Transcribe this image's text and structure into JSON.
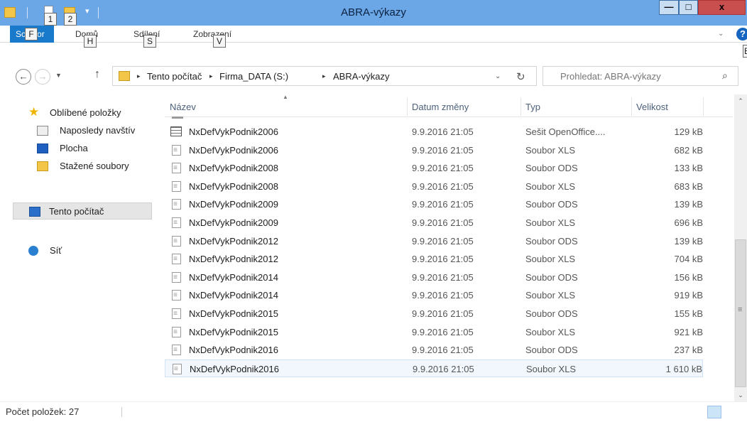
{
  "window": {
    "title": "ABRA-výkazy",
    "minimize_label": "—",
    "maximize_label": "□",
    "close_label": "x"
  },
  "quick_access": {
    "dropdown_glyph": "▾",
    "keytips": [
      "1",
      "2"
    ]
  },
  "ribbon": {
    "tabs": [
      {
        "label": "Soubor",
        "keytip": "F"
      },
      {
        "label": "Domů",
        "keytip": "H"
      },
      {
        "label": "Sdílení",
        "keytip": "S"
      },
      {
        "label": "Zobrazení",
        "keytip": "V"
      }
    ],
    "file_tab_visible": "Sc",
    "file_tab_visible_end": "or",
    "help_label": "?",
    "help_keytip": "E"
  },
  "navigation": {
    "back_glyph": "←",
    "forward_glyph": "→",
    "recent_glyph": "▼",
    "up_glyph": "↑"
  },
  "address": {
    "crumbs": [
      "Tento počítač",
      "Firma_DATA (S:)",
      "ABRA-výkazy"
    ],
    "separator": "▸",
    "dropdown_glyph": "⌄",
    "refresh_glyph": "↻"
  },
  "search": {
    "placeholder": "Prohledat: ABRA-výkazy",
    "icon_glyph": "⌕"
  },
  "nav_pane": {
    "items": [
      {
        "label": "Oblíbené položky",
        "icon": "star-icon"
      },
      {
        "label": "Naposledy navštív",
        "icon": "recent-places-icon"
      },
      {
        "label": "Plocha",
        "icon": "desktop-icon"
      },
      {
        "label": "Stažené soubory",
        "icon": "downloads-icon"
      },
      {
        "label": "Tento počítač",
        "icon": "computer-icon"
      },
      {
        "label": "Síť",
        "icon": "network-icon"
      }
    ]
  },
  "columns": {
    "name": "Název",
    "date": "Datum změny",
    "type": "Typ",
    "size": "Velikost",
    "sort_glyph": "▲"
  },
  "files": [
    {
      "name": "NxDefVykPodnik2006",
      "date": "9.9.2016 21:05",
      "type": "Sešit OpenOffice....",
      "size": "129 kB",
      "icon": "spreadsheet-icon"
    },
    {
      "name": "NxDefVykPodnik2006",
      "date": "9.9.2016 21:05",
      "type": "Soubor XLS",
      "size": "682 kB",
      "icon": "file-icon"
    },
    {
      "name": "NxDefVykPodnik2008",
      "date": "9.9.2016 21:05",
      "type": "Soubor ODS",
      "size": "133 kB",
      "icon": "file-icon"
    },
    {
      "name": "NxDefVykPodnik2008",
      "date": "9.9.2016 21:05",
      "type": "Soubor XLS",
      "size": "683 kB",
      "icon": "file-icon"
    },
    {
      "name": "NxDefVykPodnik2009",
      "date": "9.9.2016 21:05",
      "type": "Soubor ODS",
      "size": "139 kB",
      "icon": "file-icon"
    },
    {
      "name": "NxDefVykPodnik2009",
      "date": "9.9.2016 21:05",
      "type": "Soubor XLS",
      "size": "696 kB",
      "icon": "file-icon"
    },
    {
      "name": "NxDefVykPodnik2012",
      "date": "9.9.2016 21:05",
      "type": "Soubor ODS",
      "size": "139 kB",
      "icon": "file-icon"
    },
    {
      "name": "NxDefVykPodnik2012",
      "date": "9.9.2016 21:05",
      "type": "Soubor XLS",
      "size": "704 kB",
      "icon": "file-icon"
    },
    {
      "name": "NxDefVykPodnik2014",
      "date": "9.9.2016 21:05",
      "type": "Soubor ODS",
      "size": "156 kB",
      "icon": "file-icon"
    },
    {
      "name": "NxDefVykPodnik2014",
      "date": "9.9.2016 21:05",
      "type": "Soubor XLS",
      "size": "919 kB",
      "icon": "file-icon"
    },
    {
      "name": "NxDefVykPodnik2015",
      "date": "9.9.2016 21:05",
      "type": "Soubor ODS",
      "size": "155 kB",
      "icon": "file-icon"
    },
    {
      "name": "NxDefVykPodnik2015",
      "date": "9.9.2016 21:05",
      "type": "Soubor XLS",
      "size": "921 kB",
      "icon": "file-icon"
    },
    {
      "name": "NxDefVykPodnik2016",
      "date": "9.9.2016 21:05",
      "type": "Soubor ODS",
      "size": "237 kB",
      "icon": "file-icon"
    },
    {
      "name": "NxDefVykPodnik2016",
      "date": "9.9.2016 21:05",
      "type": "Soubor XLS",
      "size": "1 610 kB",
      "icon": "file-icon",
      "selected": true
    }
  ],
  "scrollbar": {
    "up_glyph": "⌃",
    "down_glyph": "⌄",
    "grip_glyph": "≡"
  },
  "status": {
    "item_count": "Počet položek: 27"
  },
  "colors": {
    "titlebar": "#6ba6e6",
    "file_tab": "#1979ca",
    "selection_bg": "#f1f7fd",
    "selection_border": "#d0e3f6"
  }
}
